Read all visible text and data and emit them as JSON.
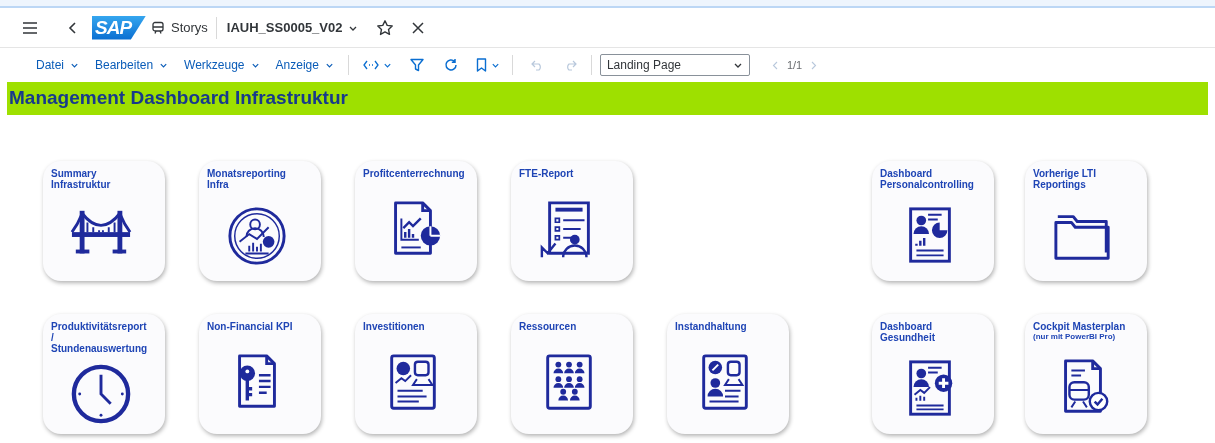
{
  "shell": {
    "logo_text": "SAP",
    "breadcrumb": "Storys",
    "story_title": "IAUH_SS0005_V02"
  },
  "toolbar": {
    "menus": [
      "Datei",
      "Bearbeiten",
      "Werkzeuge",
      "Anzeige"
    ],
    "undo_disabled": true,
    "redo_disabled": true,
    "page_select": "Landing Page",
    "pager": "1/1",
    "prev_disabled": true,
    "next_disabled": true
  },
  "banner": {
    "title": "Management Dashboard Infrastruktur"
  },
  "rows": [
    {
      "main": [
        {
          "title": "Summary Infrastruktur",
          "kind": "bridge"
        },
        {
          "title": "Monatsreporting Infra",
          "kind": "person-chart"
        },
        {
          "title": "Profitcenterrechnung",
          "kind": "report-chart"
        },
        {
          "title": "FTE-Report",
          "kind": "employee-report"
        }
      ],
      "side": [
        {
          "title": "Dashboard Personalcontrolling",
          "kind": "person-dashboard"
        },
        {
          "title": "Vorherige LTI Reportings",
          "kind": "folder"
        }
      ]
    },
    {
      "main": [
        {
          "title": "Produktivitätsreport / Stundenauswertung",
          "kind": "clock"
        },
        {
          "title": "Non-Financial KPI",
          "kind": "key-document"
        },
        {
          "title": "Investitionen",
          "kind": "invest-document"
        },
        {
          "title": "Ressourcen",
          "kind": "people-document"
        },
        {
          "title": "Instandhaltung",
          "kind": "maintenance-document"
        }
      ],
      "side": [
        {
          "title": "Dashboard Gesundheit",
          "kind": "health-document"
        },
        {
          "title": "Cockpit Masterplan",
          "note": "(nur mit PowerBI Pro)",
          "kind": "train-document"
        }
      ]
    }
  ]
}
